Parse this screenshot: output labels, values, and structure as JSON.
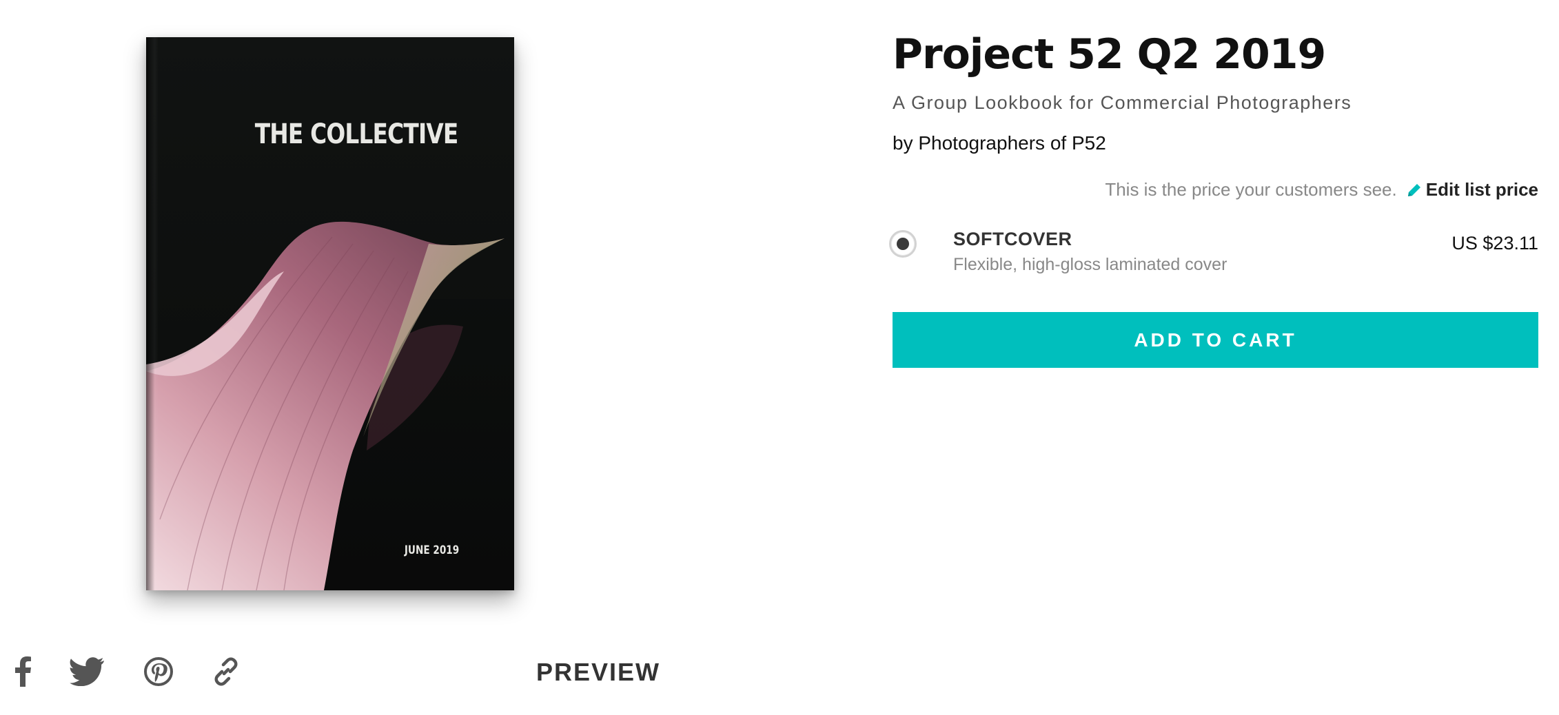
{
  "product": {
    "title": "Project 52 Q2 2019",
    "subtitle": "A Group Lookbook for Commercial Photographers",
    "author": "by Photographers of P52"
  },
  "cover": {
    "title": "THE COLLECTIVE",
    "date": "JUNE 2019"
  },
  "pricing": {
    "note": "This is the price your customers see.",
    "edit_label": "Edit list price",
    "edit_icon": "pencil-icon"
  },
  "options": [
    {
      "name": "SOFTCOVER",
      "description": "Flexible, high-gloss laminated cover",
      "price": "US $23.11",
      "selected": true
    }
  ],
  "cart": {
    "button_label": "ADD TO CART"
  },
  "share": {
    "icons": [
      "facebook-icon",
      "twitter-icon",
      "pinterest-icon",
      "link-icon"
    ],
    "preview_label": "PREVIEW"
  },
  "colors": {
    "accent": "#00bfbd",
    "text_dark": "#111111",
    "text_muted": "#888888",
    "icon_gray": "#555555"
  }
}
